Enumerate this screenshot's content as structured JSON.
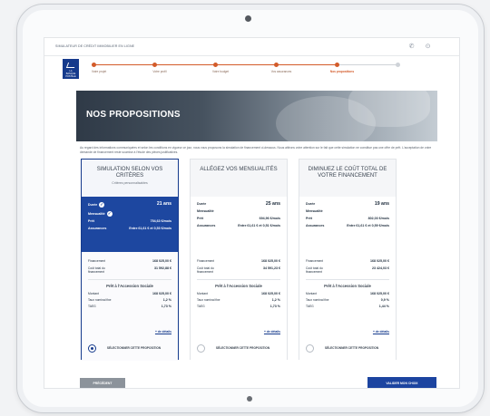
{
  "header": {
    "title": "SIMULATEUR DE CRÉDIT IMMOBILIER EN LIGNE",
    "phone_icon": "phone-icon",
    "help_icon": "help-icon"
  },
  "logo": {
    "line1": "LA",
    "line2": "BANQUE",
    "line3": "POSTALE"
  },
  "stepper": {
    "steps": [
      {
        "label": "Votre projet",
        "state": "done"
      },
      {
        "label": "Votre profil",
        "state": "done"
      },
      {
        "label": "Votre budget",
        "state": "done"
      },
      {
        "label": "Vos assurances",
        "state": "done"
      },
      {
        "label": "Nos propositions",
        "state": "active"
      },
      {
        "label": "",
        "state": "todo"
      }
    ]
  },
  "hero": {
    "title": "NOS PROPOSITIONS"
  },
  "intro": "Au regard des informations communiquées et selon les conditions en vigueur ce jour, nous vous proposons la simulation de financement ci-dessous. Nous attirons votre attention sur le fait que cette simulation ne constitue pas une offre de prêt. L'acceptation de votre demande de financement reste soumise à l'étude des pièces justificatives.",
  "cards": [
    {
      "title": "SIMULATION SELON VOS CRITÈRES",
      "subtitle": "Critères personnalisables",
      "duree_label": "Durée",
      "duree": "21 ans",
      "mensualite_label": "Mensualité",
      "pret_label": "Prêt",
      "pret": "754,63 €/mois",
      "assurances_label": "Assurances",
      "assurances": "Entre 61,61 € et 0,53 €/mois",
      "financement_label": "Financement",
      "financement": "168 025,00 €",
      "cout_label": "Coût total du financement",
      "cout": "31 592,88 €",
      "ptz_title": "Prêt à l'Accession Sociale",
      "montant_label": "Montant",
      "montant": "168 025,00 €",
      "taux_label": "Taux nominal fixe",
      "taux": "1,2 %",
      "taeg_label": "TAEG",
      "taeg": "1,73 %",
      "detail_link": "+ de détails",
      "select_label": "SÉLECTIONNER CETTE PROPOSITION",
      "selected": true
    },
    {
      "title": "ALLÉGEZ VOS MENSUALITÉS",
      "subtitle": "",
      "duree_label": "Durée",
      "duree": "25 ans",
      "mensualite_label": "Mensualité",
      "pret_label": "Prêt",
      "pret": "694,96 €/mois",
      "assurances_label": "Assurances",
      "assurances": "Entre 61,61 € et 0,51 €/mois",
      "financement_label": "Financement",
      "financement": "168 025,00 €",
      "cout_label": "Coût total du financement",
      "cout": "34 591,23 €",
      "ptz_title": "Prêt à l'Accession Sociale",
      "montant_label": "Montant",
      "montant": "168 025,00 €",
      "taux_label": "Taux nominal fixe",
      "taux": "1,2 %",
      "taeg_label": "TAEG",
      "taeg": "1,73 %",
      "detail_link": "+ de détails",
      "select_label": "SÉLECTIONNER CETTE PROPOSITION",
      "selected": false
    },
    {
      "title": "DIMINUEZ LE COÛT TOTAL DE VOTRE FINANCEMENT",
      "subtitle": "",
      "duree_label": "Durée",
      "duree": "19 ans",
      "mensualite_label": "Mensualité",
      "pret_label": "Prêt",
      "pret": "802,03 €/mois",
      "assurances_label": "Assurances",
      "assurances": "Entre 61,61 € et 0,59 €/mois",
      "financement_label": "Financement",
      "financement": "168 025,00 €",
      "cout_label": "Coût total du financement",
      "cout": "23 424,03 €",
      "ptz_title": "Prêt à l'Accession Sociale",
      "montant_label": "Montant",
      "montant": "168 025,00 €",
      "taux_label": "Taux nominal fixe",
      "taux": "0,9 %",
      "taeg_label": "TAEG",
      "taeg": "1,44 %",
      "detail_link": "+ de détails",
      "select_label": "SÉLECTIONNER CETTE PROPOSITION",
      "selected": false
    }
  ],
  "buttons": {
    "previous": "PRÉCÉDENT",
    "validate": "VALIDER MON CHOIX"
  }
}
